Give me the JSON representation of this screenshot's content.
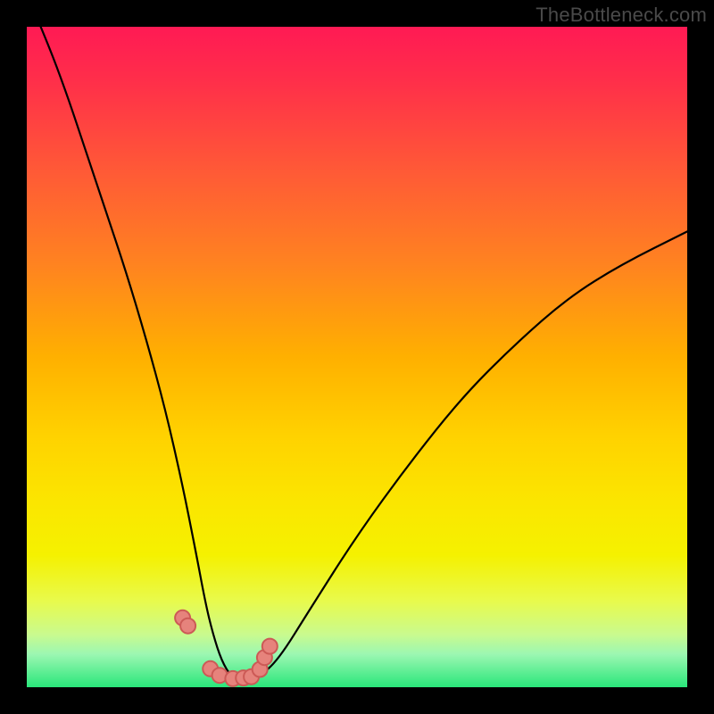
{
  "watermark": "TheBottleneck.com",
  "gradient_colors": {
    "top": "#ff1a54",
    "p08": "#ff2e4a",
    "p22": "#ff5a36",
    "p36": "#ff8320",
    "p50": "#ffb000",
    "p62": "#ffd200",
    "p72": "#fbe600",
    "p80": "#f5f100",
    "p87": "#e8fa4d",
    "p92": "#c9fa8e",
    "p95": "#9cf7b2",
    "bot": "#29e67a"
  },
  "point_style": {
    "fill": "#e6837c",
    "stroke": "#cc5a56"
  },
  "chart_data": {
    "type": "line",
    "title": "",
    "xlabel": "",
    "ylabel": "",
    "xlim": [
      0,
      100
    ],
    "ylim": [
      0,
      100
    ],
    "grid": false,
    "legend": false,
    "series": [
      {
        "name": "curve",
        "x": [
          0,
          3,
          6,
          9,
          12,
          15,
          18,
          21,
          23.5,
          25.5,
          27,
          28.2,
          29.5,
          31,
          33,
          35,
          38,
          43,
          50,
          58,
          66,
          74,
          82,
          90,
          100
        ],
        "values": [
          105,
          98,
          90,
          81,
          72,
          63,
          53,
          42,
          31,
          21,
          13,
          8,
          4,
          1.5,
          1.2,
          1.5,
          4,
          12,
          23,
          34,
          44,
          52,
          59,
          64,
          69
        ]
      }
    ],
    "scatter_points": {
      "name": "highlight-points",
      "x": [
        23.6,
        24.4,
        27.8,
        29.2,
        31.2,
        32.8,
        34.0,
        35.3,
        36.0,
        36.8
      ],
      "values": [
        10.5,
        9.3,
        2.8,
        1.8,
        1.3,
        1.4,
        1.6,
        2.7,
        4.5,
        6.2
      ]
    }
  }
}
